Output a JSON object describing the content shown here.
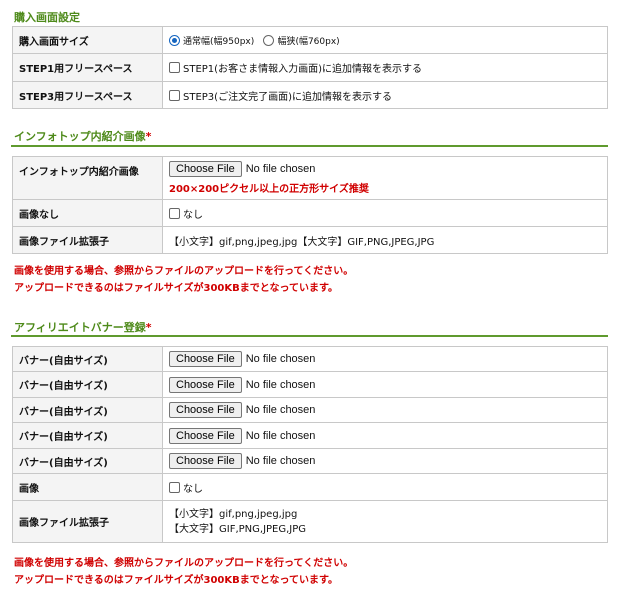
{
  "purchase": {
    "title": "購入画面設定",
    "rows": [
      {
        "label": "購入画面サイズ",
        "option1": "通常幅(幅950px)",
        "option2": "幅狭(幅760px)"
      },
      {
        "label": "STEP1用フリースペース",
        "option": "STEP1(お客さま情報入力画面)に追加情報を表示する"
      },
      {
        "label": "STEP3用フリースペース",
        "option": "STEP3(ご注文完了画面)に追加情報を表示する"
      }
    ]
  },
  "infotop": {
    "title": "インフォトップ内紹介画像",
    "required_mark": "*",
    "rows": [
      {
        "label": "インフォトップ内紹介画像",
        "button": "Choose File",
        "file": "No file chosen",
        "note": "200×200ピクセル以上の正方形サイズ推奨"
      },
      {
        "label": "画像なし",
        "option": "なし"
      },
      {
        "label": "画像ファイル拡張子",
        "value": "【小文字】gif,png,jpeg,jpg【大文字】GIF,PNG,JPEG,JPG"
      }
    ],
    "notice1": "画像を使用する場合、参照からファイルのアップロードを行ってください。",
    "notice2": "アップロードできるのはファイルサイズが300KBまでとなっています。"
  },
  "affiliate": {
    "title": "アフィリエイトバナー登録",
    "required_mark": "*",
    "banners": [
      {
        "label": "バナー(自由サイズ)",
        "button": "Choose File",
        "file": "No file chosen"
      },
      {
        "label": "バナー(自由サイズ)",
        "button": "Choose File",
        "file": "No file chosen"
      },
      {
        "label": "バナー(自由サイズ)",
        "button": "Choose File",
        "file": "No file chosen"
      },
      {
        "label": "バナー(自由サイズ)",
        "button": "Choose File",
        "file": "No file chosen"
      },
      {
        "label": "バナー(自由サイズ)",
        "button": "Choose File",
        "file": "No file chosen"
      }
    ],
    "image_row": {
      "label": "画像",
      "option": "なし"
    },
    "ext_row": {
      "label": "画像ファイル拡張子",
      "line1": "【小文字】gif,png,jpeg,jpg",
      "line2": "【大文字】GIF,PNG,JPEG,JPG"
    },
    "notice1": "画像を使用する場合、参照からファイルのアップロードを行ってください。",
    "notice2": "アップロードできるのはファイルサイズが300KBまでとなっています。"
  }
}
